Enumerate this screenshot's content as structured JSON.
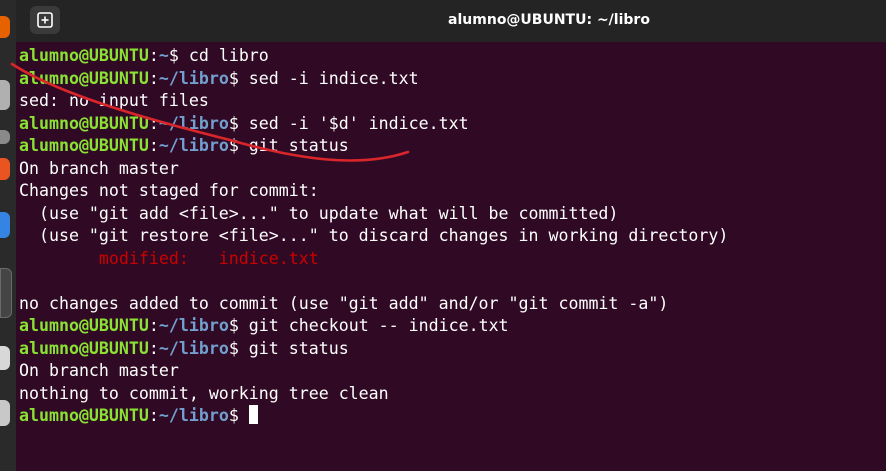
{
  "window": {
    "title": "alumno@UBUNTU: ~/libro",
    "new_tab_icon": "new-tab-icon"
  },
  "colors": {
    "terminal_bg": "#300a24",
    "titlebar_bg": "#242424",
    "prompt_user": "#8ae234",
    "prompt_path": "#729fcf",
    "modified": "#cc0000",
    "annotation_stroke": "#d9262b"
  },
  "dock": {
    "icons": [
      "browser-icon",
      "files-icon",
      "app-icon",
      "software-icon",
      "help-icon",
      "terminal-icon",
      "app-icon"
    ]
  },
  "terminal": {
    "lines": [
      {
        "user": "alumno@UBUNTU",
        "path": "~",
        "command": " cd libro"
      },
      {
        "user": "alumno@UBUNTU",
        "path": "~/libro",
        "command": " sed -i indice.txt"
      },
      {
        "text": "sed: no input files"
      },
      {
        "user": "alumno@UBUNTU",
        "path": "~/libro",
        "command": " sed -i '$d' indice.txt"
      },
      {
        "user": "alumno@UBUNTU",
        "path": "~/libro",
        "command": " git status"
      },
      {
        "text": "On branch master"
      },
      {
        "text": "Changes not staged for commit:"
      },
      {
        "text": "  (use \"git add <file>...\" to update what will be committed)"
      },
      {
        "text": "  (use \"git restore <file>...\" to discard changes in working directory)"
      },
      {
        "modified": "        modified:   indice.txt"
      },
      {
        "text": ""
      },
      {
        "text": "no changes added to commit (use \"git add\" and/or \"git commit -a\")"
      },
      {
        "user": "alumno@UBUNTU",
        "path": "~/libro",
        "command": " git checkout -- indice.txt"
      },
      {
        "user": "alumno@UBUNTU",
        "path": "~/libro",
        "command": " git status"
      },
      {
        "text": "On branch master"
      },
      {
        "text": "nothing to commit, working tree clean"
      },
      {
        "user": "alumno@UBUNTU",
        "path": "~/libro",
        "command": " ",
        "cursor": true
      }
    ]
  }
}
